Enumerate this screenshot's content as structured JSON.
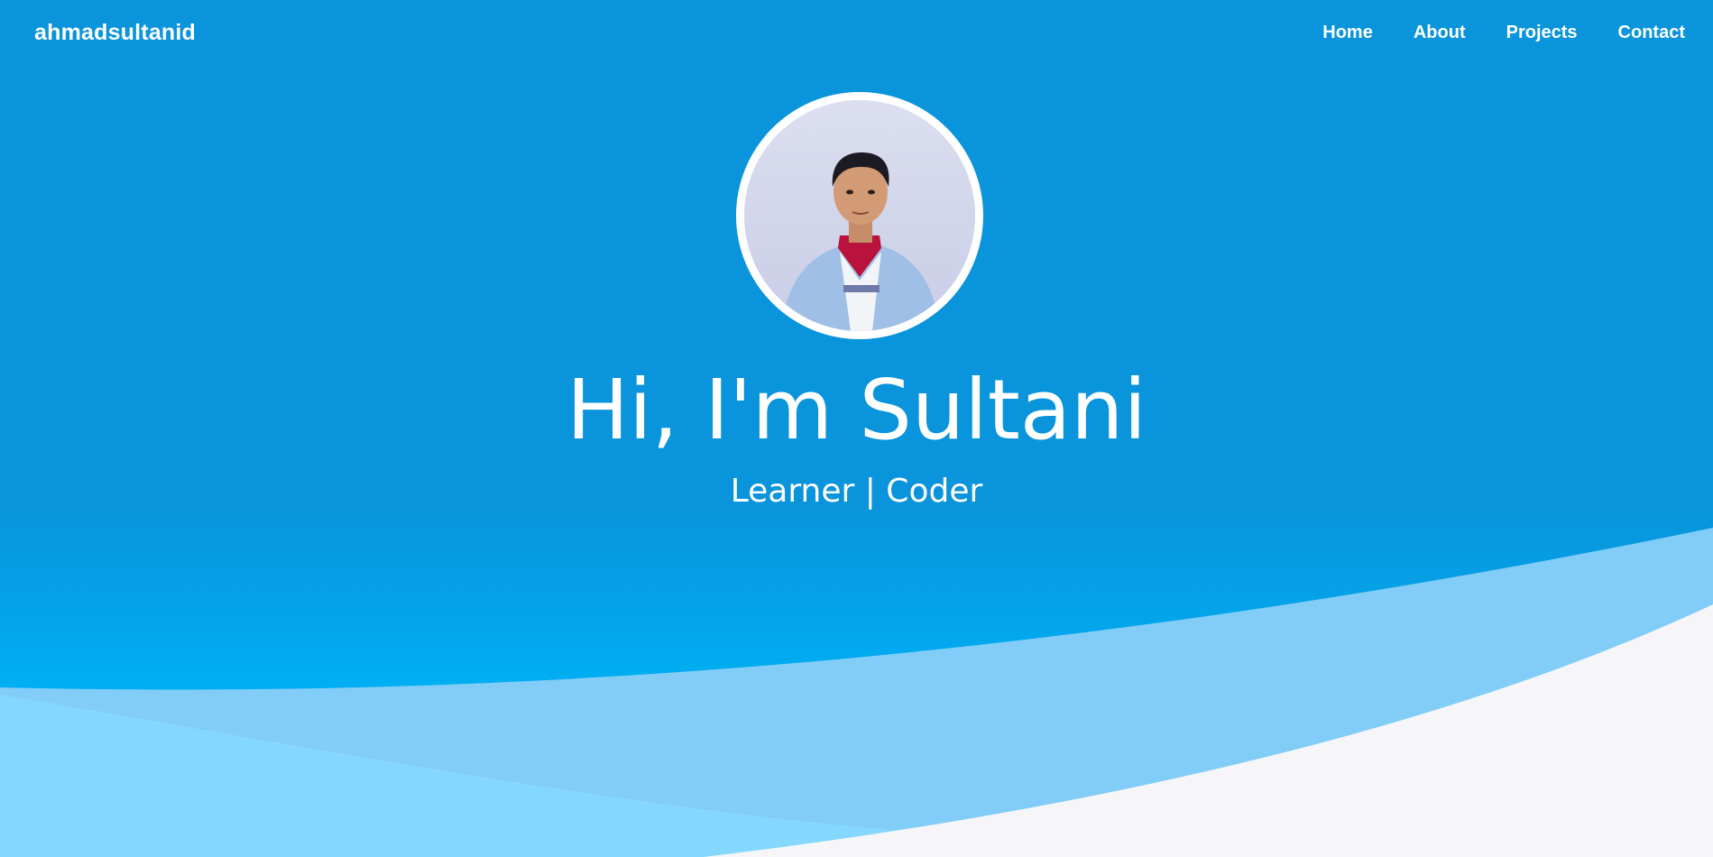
{
  "nav": {
    "brand": "ahmadsultanid",
    "links": [
      "Home",
      "About",
      "Projects",
      "Contact"
    ]
  },
  "hero": {
    "title": "Hi, I'm Sultani",
    "subtitle": "Learner | Coder"
  },
  "colors": {
    "primary_blue": "#0994db",
    "bright_blue": "#00aef3",
    "wave_light": "#82cdf7",
    "wave_white": "#f6f6f9"
  }
}
